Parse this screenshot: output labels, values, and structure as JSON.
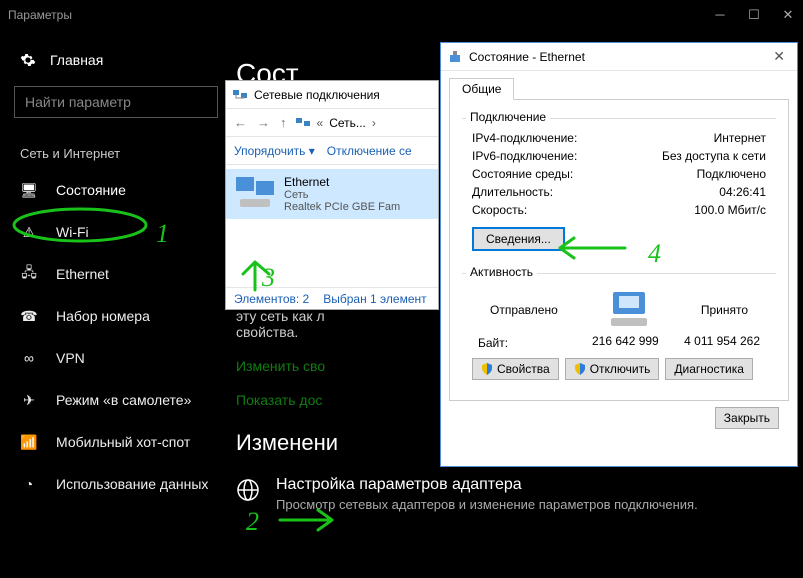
{
  "settings": {
    "window_title": "Параметры",
    "home_label": "Главная",
    "search_placeholder": "Найти параметр",
    "group_title": "Сеть и Интернет",
    "items": [
      {
        "label": "Состояние"
      },
      {
        "label": "Wi-Fi"
      },
      {
        "label": "Ethernet"
      },
      {
        "label": "Набор номера"
      },
      {
        "label": "VPN"
      },
      {
        "label": "Режим «в самолете»"
      },
      {
        "label": "Мобильный хот-спот"
      },
      {
        "label": "Использование данных"
      }
    ],
    "page_title": "Сост",
    "snippet_line1": "эту сеть как л",
    "snippet_line2": "свойства.",
    "link1": "Изменить сво",
    "link2": "Показать дос",
    "subhead": "Изменени",
    "adapter_title": "Настройка параметров адаптера",
    "adapter_desc": "Просмотр сетевых адаптеров и изменение параметров подключения."
  },
  "explorer": {
    "title": "Сетевые подключения",
    "crumb1": "Сеть...",
    "toolbar": {
      "organize": "Упорядочить",
      "disable": "Отключение се"
    },
    "item": {
      "name": "Ethernet",
      "line2": "Сеть",
      "line3": "Realtek PCIe GBE Fam"
    },
    "status": {
      "elements": "Элементов: 2",
      "selected": "Выбран 1 элемент"
    }
  },
  "dialog": {
    "title": "Состояние - Ethernet",
    "tab": "Общие",
    "group_connection": "Подключение",
    "rows": [
      {
        "k": "IPv4-подключение:",
        "v": "Интернет"
      },
      {
        "k": "IPv6-подключение:",
        "v": "Без доступа к сети"
      },
      {
        "k": "Состояние среды:",
        "v": "Подключено"
      },
      {
        "k": "Длительность:",
        "v": "04:26:41"
      },
      {
        "k": "Скорость:",
        "v": "100.0 Мбит/с"
      }
    ],
    "details_btn": "Сведения...",
    "group_activity": "Активность",
    "activity": {
      "sent_label": "Отправлено",
      "recv_label": "Принято",
      "bytes_label": "Байт:",
      "sent": "216 642 999",
      "recv": "4 011 954 262"
    },
    "buttons": {
      "props": "Свойства",
      "disable": "Отключить",
      "diag": "Диагностика",
      "close": "Закрыть"
    }
  },
  "annotations": {
    "n1": "1",
    "n2": "2",
    "n3": "3",
    "n4": "4"
  }
}
